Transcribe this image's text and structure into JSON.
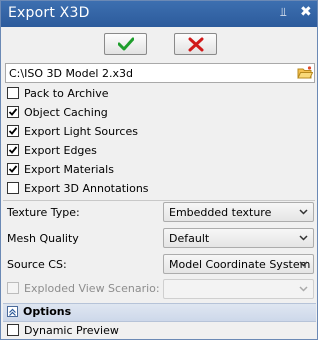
{
  "window": {
    "title": "Export X3D",
    "pin_glyph": "⫫",
    "close_glyph": "✖"
  },
  "actions": {
    "ok": "ok-check-icon",
    "cancel": "cancel-x-icon"
  },
  "file": {
    "path": "C:\\ISO 3D Model 2.x3d",
    "browse_icon": "folder-icon"
  },
  "checkboxes": [
    {
      "label": "Pack to Archive",
      "checked": false
    },
    {
      "label": "Object Caching",
      "checked": true
    },
    {
      "label": "Export Light Sources",
      "checked": true
    },
    {
      "label": "Export Edges",
      "checked": true
    },
    {
      "label": "Export Materials",
      "checked": true
    },
    {
      "label": "Export 3D Annotations",
      "checked": false
    }
  ],
  "settings": {
    "texture_type": {
      "label": "Texture Type:",
      "value": "Embedded texture"
    },
    "mesh_quality": {
      "label": "Mesh Quality",
      "value": "Default"
    },
    "source_cs": {
      "label": "Source CS:",
      "value": "Model Coordinate System"
    },
    "exploded_view": {
      "label": "Exploded View Scenario:",
      "value": "",
      "enabled": false
    }
  },
  "options": {
    "header": "Options",
    "dynamic_preview": {
      "label": "Dynamic Preview",
      "checked": false
    }
  },
  "colors": {
    "title_bar": "#2f5fa0",
    "ok_green": "#1e9e2c",
    "cancel_red": "#d11a1a"
  }
}
